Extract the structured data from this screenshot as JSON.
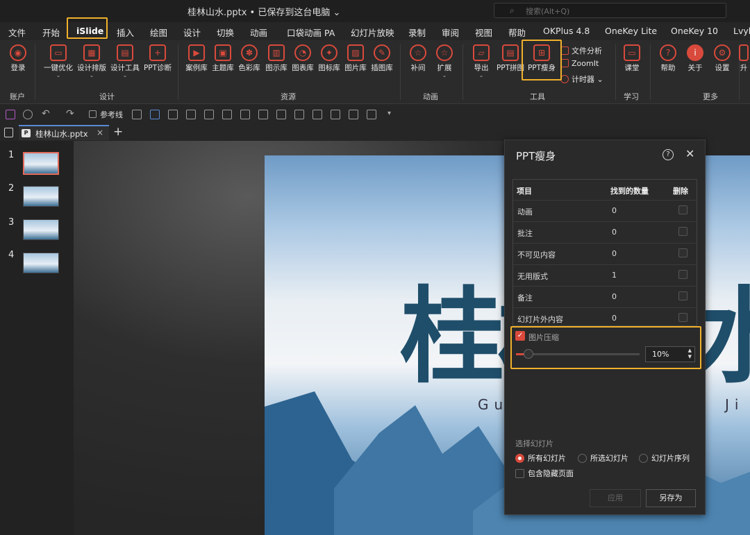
{
  "window": {
    "title": "桂林山水.pptx • 已保存到这台电脑 ⌄",
    "search_placeholder": "搜索(Alt+Q)"
  },
  "tabs": [
    "文件",
    "开始",
    "iSlide",
    "插入",
    "绘图",
    "设计",
    "切换",
    "动画",
    "口袋动画 PA",
    "幻灯片放映",
    "录制",
    "审阅",
    "视图",
    "帮助",
    "OKPlus 4.8",
    "OneKey Lite",
    "OneKey 10",
    "Lvyh"
  ],
  "ribbon": {
    "buttons": {
      "login": "登录",
      "optimize": "一键优化",
      "layout": "设计排版",
      "tools": "设计工具",
      "diagnose": "PPT诊断",
      "cases": "案例库",
      "themes": "主题库",
      "colors": "色彩库",
      "diagram": "图示库",
      "charts": "图表库",
      "icons": "图标库",
      "pictures": "图片库",
      "illus": "插图库",
      "tween": "补间",
      "extend": "扩展",
      "export": "导出",
      "puzzle": "PPT拼图",
      "slim": "PPT瘦身",
      "analysis": "文件分析",
      "zoomit": "ZoomIt",
      "timer": "计时器",
      "classroom": "课堂",
      "help": "帮助",
      "about": "关于",
      "settings": "设置",
      "more_cut": "升"
    },
    "groups": {
      "account": "账户",
      "design": "设计",
      "resources": "资源",
      "animation": "动画",
      "tools": "工具",
      "learn": "学习",
      "more": "更多"
    }
  },
  "quickbar": {
    "guides": "参考线"
  },
  "doc_tab": {
    "name": "桂林山水.pptx"
  },
  "thumbnails": [
    "1",
    "2",
    "3",
    "4"
  ],
  "slide": {
    "title_chars": "桂林山水",
    "left_sub": "Gu",
    "right_sub": "Ji"
  },
  "dialog": {
    "title": "PPT瘦身",
    "columns": {
      "item": "项目",
      "found": "找到的数量",
      "delete": "删除"
    },
    "rows": [
      {
        "item": "动画",
        "count": "0"
      },
      {
        "item": "批注",
        "count": "0"
      },
      {
        "item": "不可见内容",
        "count": "0"
      },
      {
        "item": "无用版式",
        "count": "1"
      },
      {
        "item": "备注",
        "count": "0"
      },
      {
        "item": "幻灯片外内容",
        "count": "0"
      }
    ],
    "compress_label": "图片压缩",
    "compress_value": "10%",
    "compress_level": 0.1,
    "select_label": "选择幻灯片",
    "radios": [
      "所有幻灯片",
      "所选幻灯片",
      "幻灯片序列"
    ],
    "include_hidden": "包含隐藏页面",
    "apply": "应用",
    "save_as": "另存为"
  }
}
